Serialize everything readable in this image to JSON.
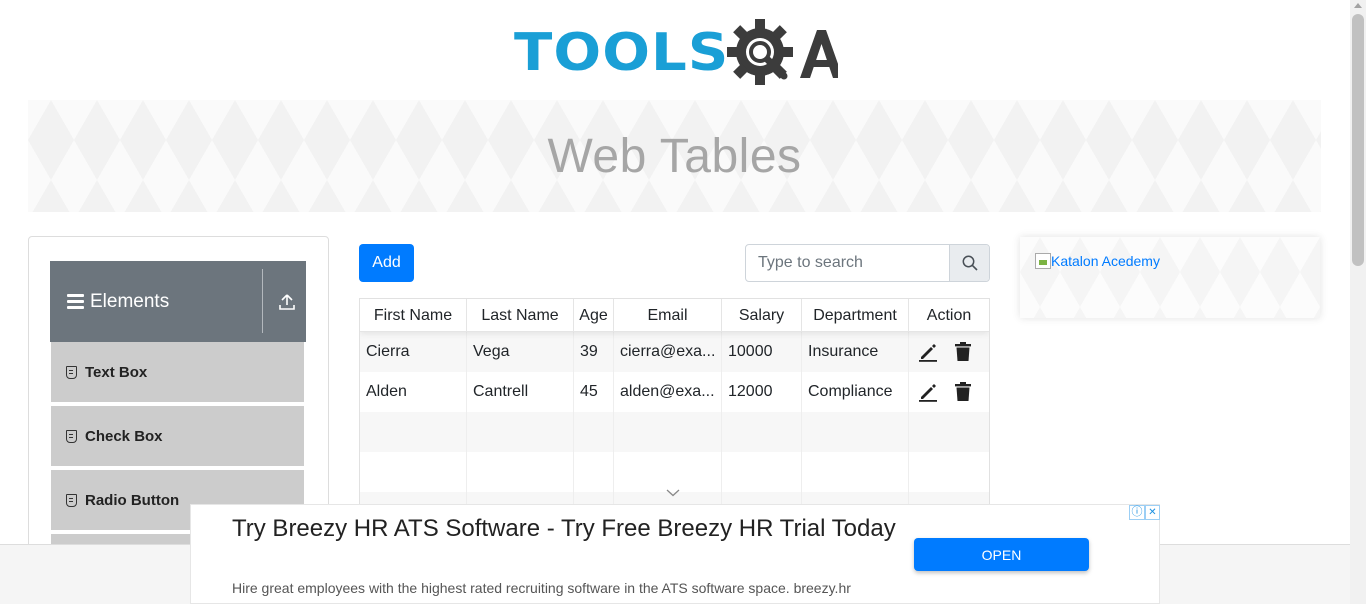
{
  "logo": {
    "text": "TOOLS",
    "text_suffix": "QA",
    "primary_color": "#1a9fd6",
    "secondary_color": "#3c3c3c"
  },
  "banner": {
    "title": "Web Tables"
  },
  "sidebar": {
    "group_title": "Elements",
    "items": [
      {
        "label": "Text Box",
        "icon": "html5-icon"
      },
      {
        "label": "Check Box",
        "icon": "html5-icon"
      },
      {
        "label": "Radio Button",
        "icon": "html5-icon"
      }
    ]
  },
  "toolbar": {
    "add_label": "Add",
    "search_placeholder": "Type to search",
    "search_value": ""
  },
  "table": {
    "columns": [
      "First Name",
      "Last Name",
      "Age",
      "Email",
      "Salary",
      "Department",
      "Action"
    ],
    "rows": [
      [
        "Cierra",
        "Vega",
        "39",
        "cierra@exa...",
        "10000",
        "Insurance"
      ],
      [
        "Alden",
        "Cantrell",
        "45",
        "alden@exa...",
        "12000",
        "Compliance"
      ]
    ]
  },
  "side_ad": {
    "alt_text": "Katalon Acedemy"
  },
  "bottom_ad": {
    "title": "Try Breezy HR ATS Software - Try Free Breezy HR Trial Today",
    "description": "Hire great employees with the highest rated recruiting software in the ATS software space. breezy.hr",
    "cta_label": "OPEN",
    "info_symbol": "ⓘ",
    "close_symbol": "✕"
  },
  "colors": {
    "accent": "#007bff",
    "sidebar_header": "#6c757d",
    "sidebar_item": "#cccccc"
  }
}
